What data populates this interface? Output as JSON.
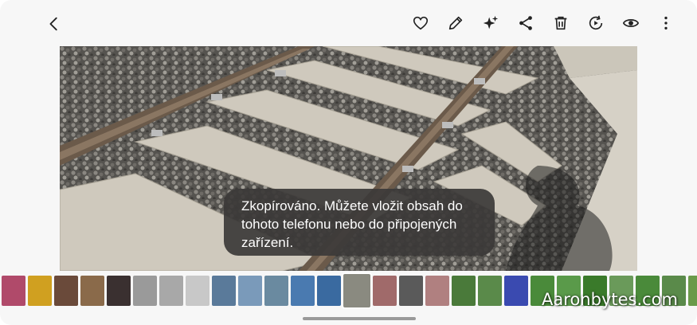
{
  "toolbar": {
    "back_icon": "back-arrow-icon",
    "actions": [
      "heart-icon",
      "edit-pencil-icon",
      "sparkle-ai-icon",
      "share-icon",
      "delete-icon",
      "remaster-icon",
      "eye-icon",
      "more-vert-icon"
    ]
  },
  "toast": {
    "line1": "Zkopírováno. Můžete vložit obsah do",
    "line2": "tohoto telefonu nebo do připojených",
    "line3": "zařízení."
  },
  "watermark": "Aaronbytes.com",
  "filmstrip": {
    "thumb_colors": [
      "#b04a6a",
      "#d0a020",
      "#6a4a3a",
      "#8a6a4a",
      "#3a3030",
      "#9a9a9a",
      "#a8a8a8",
      "#c8c8c8",
      "#5a7a9a",
      "#7a9aba",
      "#6a8aa0",
      "#4a7ab0",
      "#3a6aa0",
      "#8a8a80",
      "#a06a6a",
      "#5a5a5a",
      "#b08080",
      "#4a7a3a",
      "#5a8a4a",
      "#3a4ab0",
      "#4a8a3a",
      "#5a9a4a",
      "#3a7a2a",
      "#6a9a5a",
      "#4a8a3a",
      "#5a8a4a",
      "#6a9a4a"
    ],
    "selected_index": 13
  }
}
